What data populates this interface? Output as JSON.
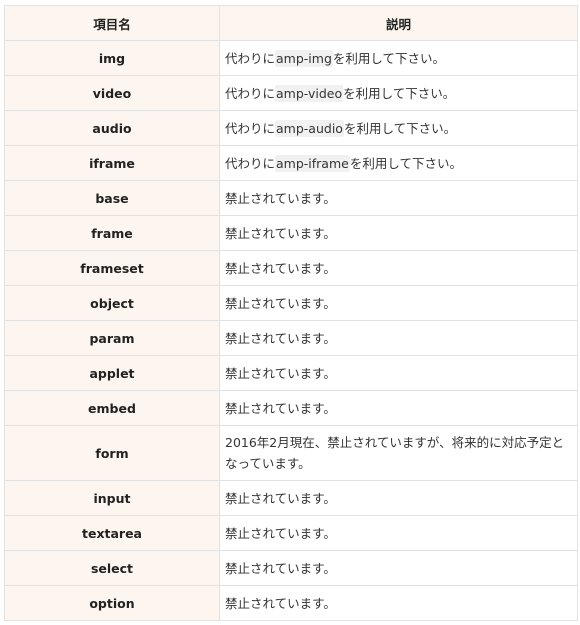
{
  "table": {
    "headers": {
      "name": "項目名",
      "description": "説明"
    },
    "rows": [
      {
        "name": "img",
        "desc_before": "代わりに",
        "code": "amp-img",
        "desc_after": "を利用して下さい。"
      },
      {
        "name": "video",
        "desc_before": "代わりに",
        "code": "amp-video",
        "desc_after": "を利用して下さい。"
      },
      {
        "name": "audio",
        "desc_before": "代わりに",
        "code": "amp-audio",
        "desc_after": "を利用して下さい。"
      },
      {
        "name": "iframe",
        "desc_before": "代わりに",
        "code": "amp-iframe",
        "desc_after": "を利用して下さい。"
      },
      {
        "name": "base",
        "desc": "禁止されています。"
      },
      {
        "name": "frame",
        "desc": "禁止されています。"
      },
      {
        "name": "frameset",
        "desc": "禁止されています。"
      },
      {
        "name": "object",
        "desc": "禁止されています。"
      },
      {
        "name": "param",
        "desc": "禁止されています。"
      },
      {
        "name": "applet",
        "desc": "禁止されています。"
      },
      {
        "name": "embed",
        "desc": "禁止されています。"
      },
      {
        "name": "form",
        "desc": "2016年2月現在、禁止されていますが、将来的に対応予定となっています。"
      },
      {
        "name": "input",
        "desc": "禁止されています。"
      },
      {
        "name": "textarea",
        "desc": "禁止されています。"
      },
      {
        "name": "select",
        "desc": "禁止されています。"
      },
      {
        "name": "option",
        "desc": "禁止されています。"
      }
    ]
  }
}
